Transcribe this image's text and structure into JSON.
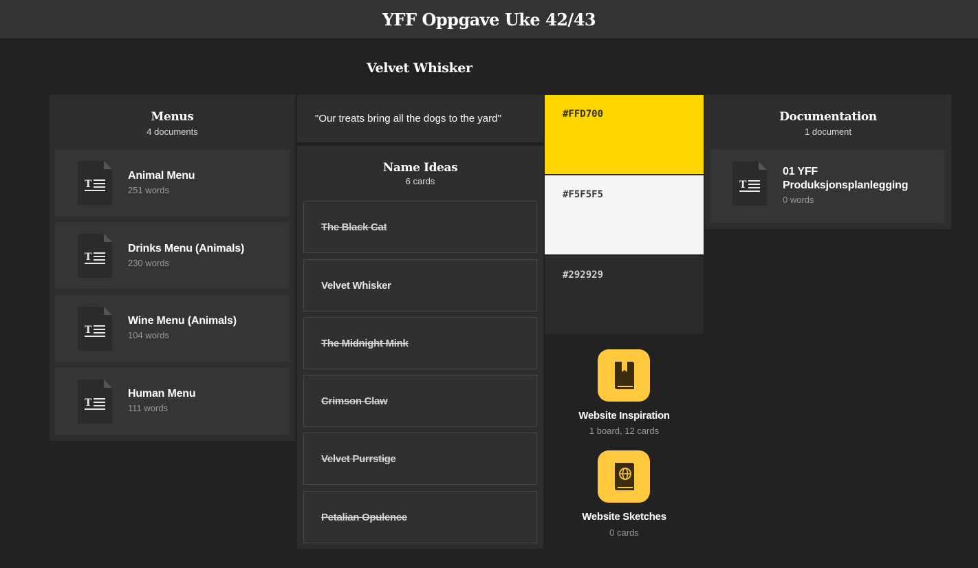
{
  "header": {
    "title": "YFF Oppgave Uke 42/43"
  },
  "board": {
    "title": "Velvet Whisker"
  },
  "menus": {
    "title": "Menus",
    "count": "4 documents",
    "items": [
      {
        "name": "Animal Menu",
        "words": "251 words"
      },
      {
        "name": "Drinks Menu (Animals)",
        "words": "230 words"
      },
      {
        "name": "Wine Menu (Animals)",
        "words": "104 words"
      },
      {
        "name": "Human Menu",
        "words": "111 words"
      }
    ]
  },
  "quote": {
    "text": "\"Our treats bring all the dogs to the yard\""
  },
  "name_ideas": {
    "title": "Name Ideas",
    "count": "6 cards",
    "cards": [
      {
        "text": "The Black Cat",
        "struck": true
      },
      {
        "text": "Velvet Whisker",
        "struck": false
      },
      {
        "text": "The Midnight Mink",
        "struck": true
      },
      {
        "text": "Crimson Claw",
        "struck": true
      },
      {
        "text": "Velvet Purrstige",
        "struck": true
      },
      {
        "text": "Petalian Opulence",
        "struck": true
      }
    ]
  },
  "palette": {
    "swatches": [
      {
        "label": "#FFD700",
        "color": "#FFD700",
        "text_color": "#3a3000"
      },
      {
        "label": "#F5F5F5",
        "color": "#F5F5F5",
        "text_color": "#3a3a3a"
      },
      {
        "label": "#292929",
        "color": "#292929",
        "text_color": "#cfcfcf"
      }
    ]
  },
  "boards": [
    {
      "name": "Website Inspiration",
      "sub": "1 board, 12 cards",
      "icon": "bookmark-book-icon"
    },
    {
      "name": "Website Sketches",
      "sub": "0 cards",
      "icon": "globe-book-icon"
    }
  ],
  "documentation": {
    "title": "Documentation",
    "count": "1 document",
    "items": [
      {
        "name_line1": "01 YFF",
        "name_line2": "Produksjonsplanlegging",
        "words": "0 words"
      }
    ]
  },
  "colors": {
    "accent": "#ffc83d",
    "background": "#222222",
    "panel": "#2e2e2e",
    "card": "#353535"
  }
}
